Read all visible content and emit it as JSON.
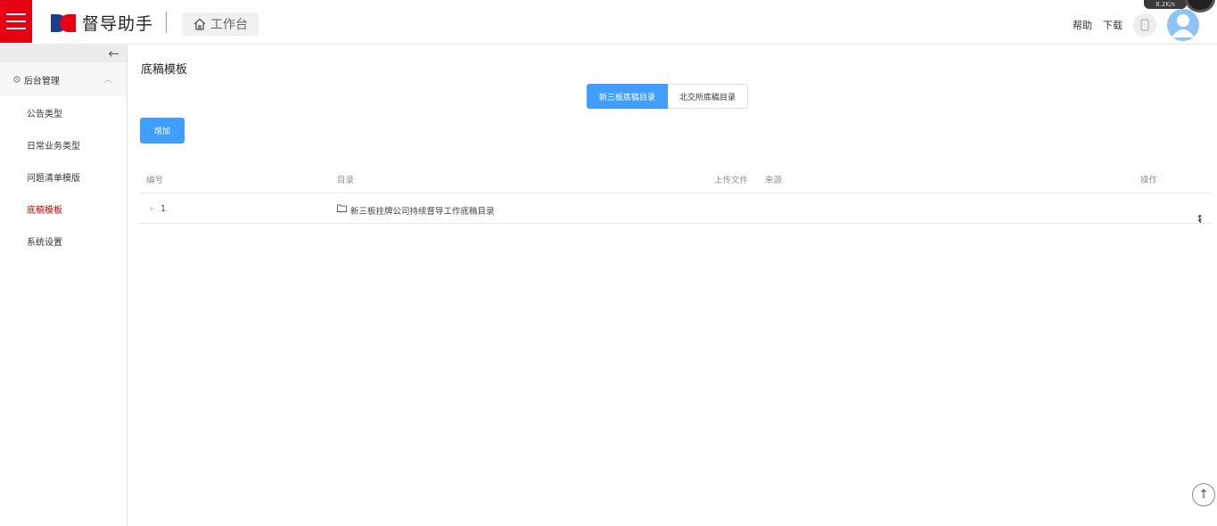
{
  "app": {
    "title": "督导助手",
    "workbench_label": "工作台"
  },
  "header": {
    "help_label": "帮助",
    "download_label": "下载",
    "net_speed": "8.2K/s"
  },
  "sidebar": {
    "group_label": "后台管理",
    "items": [
      {
        "label": "公告类型",
        "active": false
      },
      {
        "label": "日常业务类型",
        "active": false
      },
      {
        "label": "问题清单模版",
        "active": false
      },
      {
        "label": "底稿模板",
        "active": true
      },
      {
        "label": "系统设置",
        "active": false
      }
    ]
  },
  "main": {
    "page_title": "底稿模板",
    "tabs": [
      "新三板底稿目录",
      "北交所底稿目录"
    ],
    "add_button": "增加",
    "table": {
      "columns": [
        "编号",
        "目录",
        "上传文件",
        "来源",
        "操作"
      ],
      "rows": [
        {
          "id": "1",
          "directory": "新三板挂牌公司持续督导工作底稿目录",
          "upload": "",
          "source": ""
        }
      ]
    }
  },
  "colors": {
    "brand_red": "#e60012",
    "primary_blue": "#409eff",
    "active_menu": "#cc0000"
  }
}
